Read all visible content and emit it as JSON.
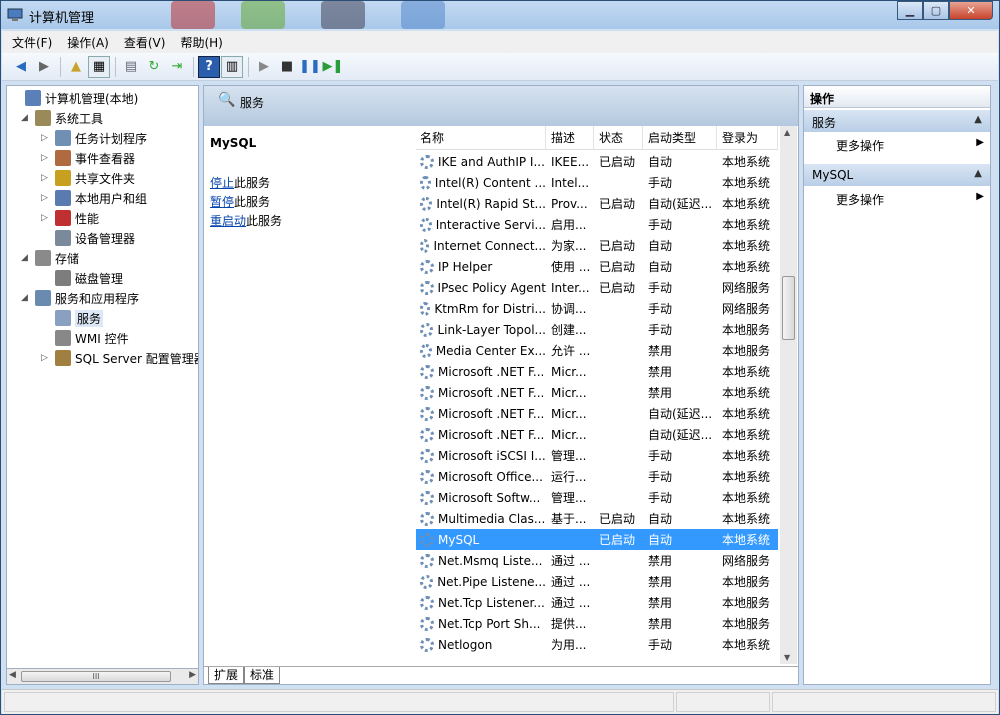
{
  "window": {
    "title": "计算机管理"
  },
  "menu": [
    "文件(F)",
    "操作(A)",
    "查看(V)",
    "帮助(H)"
  ],
  "tree": [
    {
      "label": "计算机管理(本地)",
      "level": 0,
      "expander": ""
    },
    {
      "label": "系统工具",
      "level": 1,
      "expander": "◢"
    },
    {
      "label": "任务计划程序",
      "level": 2,
      "expander": "▷"
    },
    {
      "label": "事件查看器",
      "level": 2,
      "expander": "▷"
    },
    {
      "label": "共享文件夹",
      "level": 2,
      "expander": "▷"
    },
    {
      "label": "本地用户和组",
      "level": 2,
      "expander": "▷"
    },
    {
      "label": "性能",
      "level": 2,
      "expander": "▷"
    },
    {
      "label": "设备管理器",
      "level": 2,
      "expander": ""
    },
    {
      "label": "存储",
      "level": 1,
      "expander": "◢"
    },
    {
      "label": "磁盘管理",
      "level": 2,
      "expander": ""
    },
    {
      "label": "服务和应用程序",
      "level": 1,
      "expander": "◢"
    },
    {
      "label": "服务",
      "level": 2,
      "expander": "",
      "selected": true
    },
    {
      "label": "WMI 控件",
      "level": 2,
      "expander": ""
    },
    {
      "label": "SQL Server 配置管理器",
      "level": 2,
      "expander": "▷"
    }
  ],
  "hscroll_grip": "III",
  "center": {
    "header": "服务",
    "detail": {
      "name": "MySQL",
      "actions": [
        {
          "link": "停止",
          "rest": "此服务"
        },
        {
          "link": "暂停",
          "rest": "此服务"
        },
        {
          "link": "重启动",
          "rest": "此服务"
        }
      ]
    },
    "columns": [
      "名称",
      "描述",
      "状态",
      "启动类型",
      "登录为"
    ],
    "rows": [
      [
        "IKE and AuthIP I...",
        "IKEE...",
        "已启动",
        "自动",
        "本地系统"
      ],
      [
        "Intel(R) Content ...",
        "Intel...",
        "",
        "手动",
        "本地系统"
      ],
      [
        "Intel(R) Rapid St...",
        "Prov...",
        "已启动",
        "自动(延迟...",
        "本地系统"
      ],
      [
        "Interactive Servi...",
        "启用...",
        "",
        "手动",
        "本地系统"
      ],
      [
        "Internet Connect...",
        "为家...",
        "已启动",
        "自动",
        "本地系统"
      ],
      [
        "IP Helper",
        "使用 ...",
        "已启动",
        "自动",
        "本地系统"
      ],
      [
        "IPsec Policy Agent",
        "Inter...",
        "已启动",
        "手动",
        "网络服务"
      ],
      [
        "KtmRm for Distri...",
        "协调...",
        "",
        "手动",
        "网络服务"
      ],
      [
        "Link-Layer Topol...",
        "创建...",
        "",
        "手动",
        "本地服务"
      ],
      [
        "Media Center Ex...",
        "允许 ...",
        "",
        "禁用",
        "本地服务"
      ],
      [
        "Microsoft .NET F...",
        "Micr...",
        "",
        "禁用",
        "本地系统"
      ],
      [
        "Microsoft .NET F...",
        "Micr...",
        "",
        "禁用",
        "本地系统"
      ],
      [
        "Microsoft .NET F...",
        "Micr...",
        "",
        "自动(延迟...",
        "本地系统"
      ],
      [
        "Microsoft .NET F...",
        "Micr...",
        "",
        "自动(延迟...",
        "本地系统"
      ],
      [
        "Microsoft iSCSI I...",
        "管理...",
        "",
        "手动",
        "本地系统"
      ],
      [
        "Microsoft Office...",
        "运行...",
        "",
        "手动",
        "本地系统"
      ],
      [
        "Microsoft Softw...",
        "管理...",
        "",
        "手动",
        "本地系统"
      ],
      [
        "Multimedia Clas...",
        "基于...",
        "已启动",
        "自动",
        "本地系统"
      ],
      [
        "MySQL",
        "",
        "已启动",
        "自动",
        "本地系统"
      ],
      [
        "Net.Msmq Liste...",
        "通过 ...",
        "",
        "禁用",
        "网络服务"
      ],
      [
        "Net.Pipe Listene...",
        "通过 ...",
        "",
        "禁用",
        "本地服务"
      ],
      [
        "Net.Tcp Listener...",
        "通过 ...",
        "",
        "禁用",
        "本地服务"
      ],
      [
        "Net.Tcp Port Sh...",
        "提供...",
        "",
        "禁用",
        "本地服务"
      ],
      [
        "Netlogon",
        "为用...",
        "",
        "手动",
        "本地系统"
      ]
    ],
    "selected_row": 18,
    "tabs": [
      "扩展",
      "标准"
    ]
  },
  "actions": {
    "header": "操作",
    "sections": [
      {
        "title": "服务",
        "items": [
          "更多操作"
        ]
      },
      {
        "title": "MySQL",
        "items": [
          "更多操作"
        ]
      }
    ]
  }
}
